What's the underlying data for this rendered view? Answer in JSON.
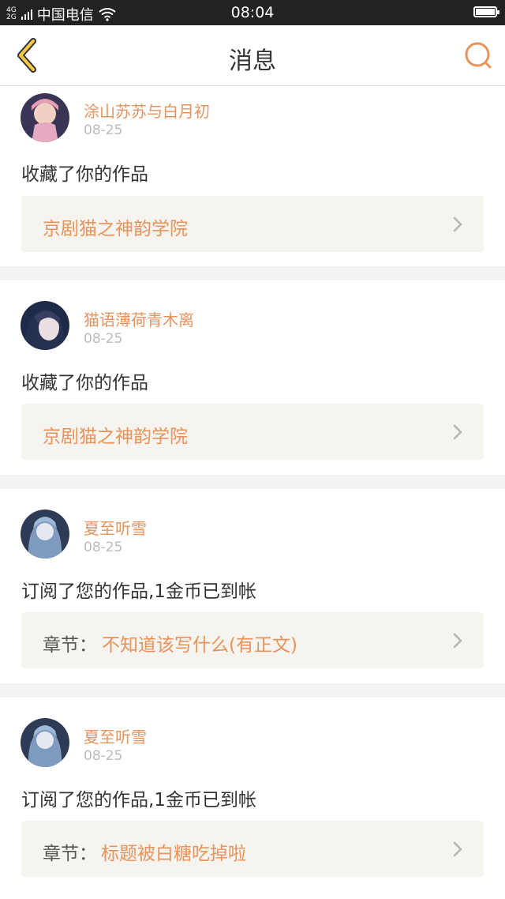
{
  "statusbar": {
    "network_top": "4G",
    "network_bottom": "2G",
    "carrier": "中国电信",
    "time": "08:04"
  },
  "navbar": {
    "title": "消息",
    "back_icon": "chevron-left-icon",
    "search_icon": "search-icon",
    "accent_color": "#e8935c"
  },
  "messages": [
    {
      "username": "涂山苏苏与白月初",
      "date": "08-25",
      "action": "收藏了你的作品",
      "work_label": "",
      "work_title": "京剧猫之神韵学院"
    },
    {
      "username": "猫语薄荷青木离",
      "date": "08-25",
      "action": "收藏了你的作品",
      "work_label": "",
      "work_title": "京剧猫之神韵学院"
    },
    {
      "username": "夏至听雪",
      "date": "08-25",
      "action": "订阅了您的作品,1金币已到帐",
      "work_label": "章节：",
      "work_title": "不知道该写什么(有正文)"
    },
    {
      "username": "夏至听雪",
      "date": "08-25",
      "action": "订阅了您的作品,1金币已到帐",
      "work_label": "章节：",
      "work_title": "标题被白糖吃掉啦"
    }
  ]
}
